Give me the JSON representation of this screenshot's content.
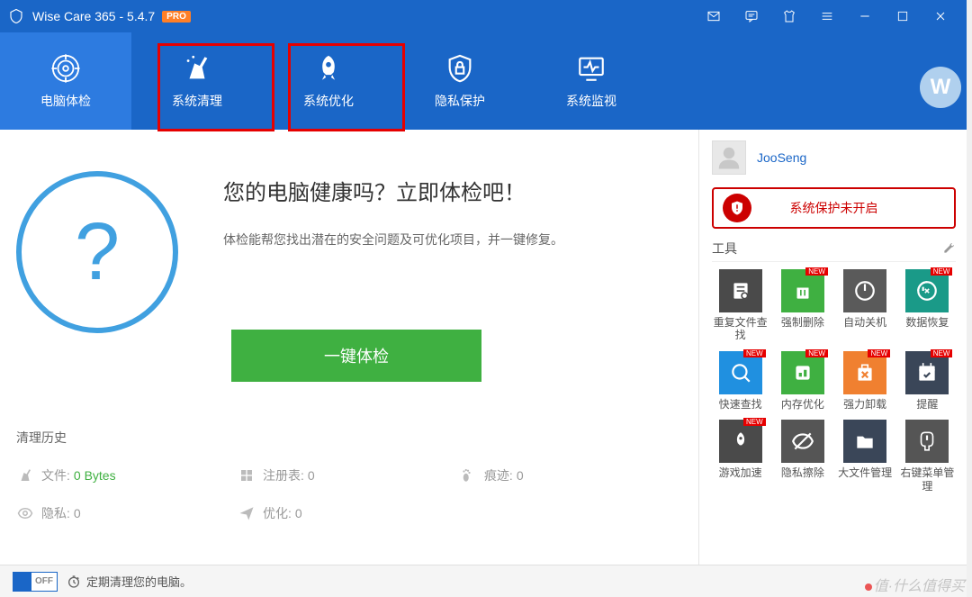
{
  "title": "Wise Care 365 - 5.4.7",
  "pro_badge": "PRO",
  "nav": [
    {
      "label": "电脑体检"
    },
    {
      "label": "系统清理"
    },
    {
      "label": "系统优化"
    },
    {
      "label": "隐私保护"
    },
    {
      "label": "系统监视"
    }
  ],
  "headline": "您的电脑健康吗？立即体检吧！",
  "subline": "体检能帮您找出潜在的安全问题及可优化项目，并一键修复。",
  "scan_button": "一键体检",
  "history_title": "清理历史",
  "history": {
    "files_label": "文件:",
    "files_value": "0 Bytes",
    "registry_label": "注册表:",
    "registry_value": "0",
    "traces_label": "痕迹:",
    "traces_value": "0",
    "privacy_label": "隐私:",
    "privacy_value": "0",
    "optimize_label": "优化:",
    "optimize_value": "0"
  },
  "user": {
    "name": "JooSeng"
  },
  "protection_text": "系统保护未开启",
  "tools_header": "工具",
  "new_badge_text": "NEW",
  "tools": [
    {
      "label": "重复文件查找",
      "color": "c-gray4",
      "new": false
    },
    {
      "label": "强制删除",
      "color": "c-green",
      "new": true
    },
    {
      "label": "自动关机",
      "color": "c-gray6",
      "new": false
    },
    {
      "label": "数据恢复",
      "color": "c-teal",
      "new": true
    },
    {
      "label": "快速查找",
      "color": "c-blue",
      "new": true
    },
    {
      "label": "内存优化",
      "color": "c-green",
      "new": true
    },
    {
      "label": "强力卸载",
      "color": "c-orange",
      "new": true
    },
    {
      "label": "提醒",
      "color": "c-navy",
      "new": true
    },
    {
      "label": "游戏加速",
      "color": "c-gray4",
      "new": true
    },
    {
      "label": "隐私擦除",
      "color": "c-gray5",
      "new": false
    },
    {
      "label": "大文件管理",
      "color": "c-navy",
      "new": false
    },
    {
      "label": "右键菜单管理",
      "color": "c-gray5",
      "new": false
    }
  ],
  "bottom": {
    "toggle_text": "OFF",
    "schedule_text": "定期清理您的电脑。"
  },
  "logo_letter": "W",
  "watermark": "值·什么值得买"
}
